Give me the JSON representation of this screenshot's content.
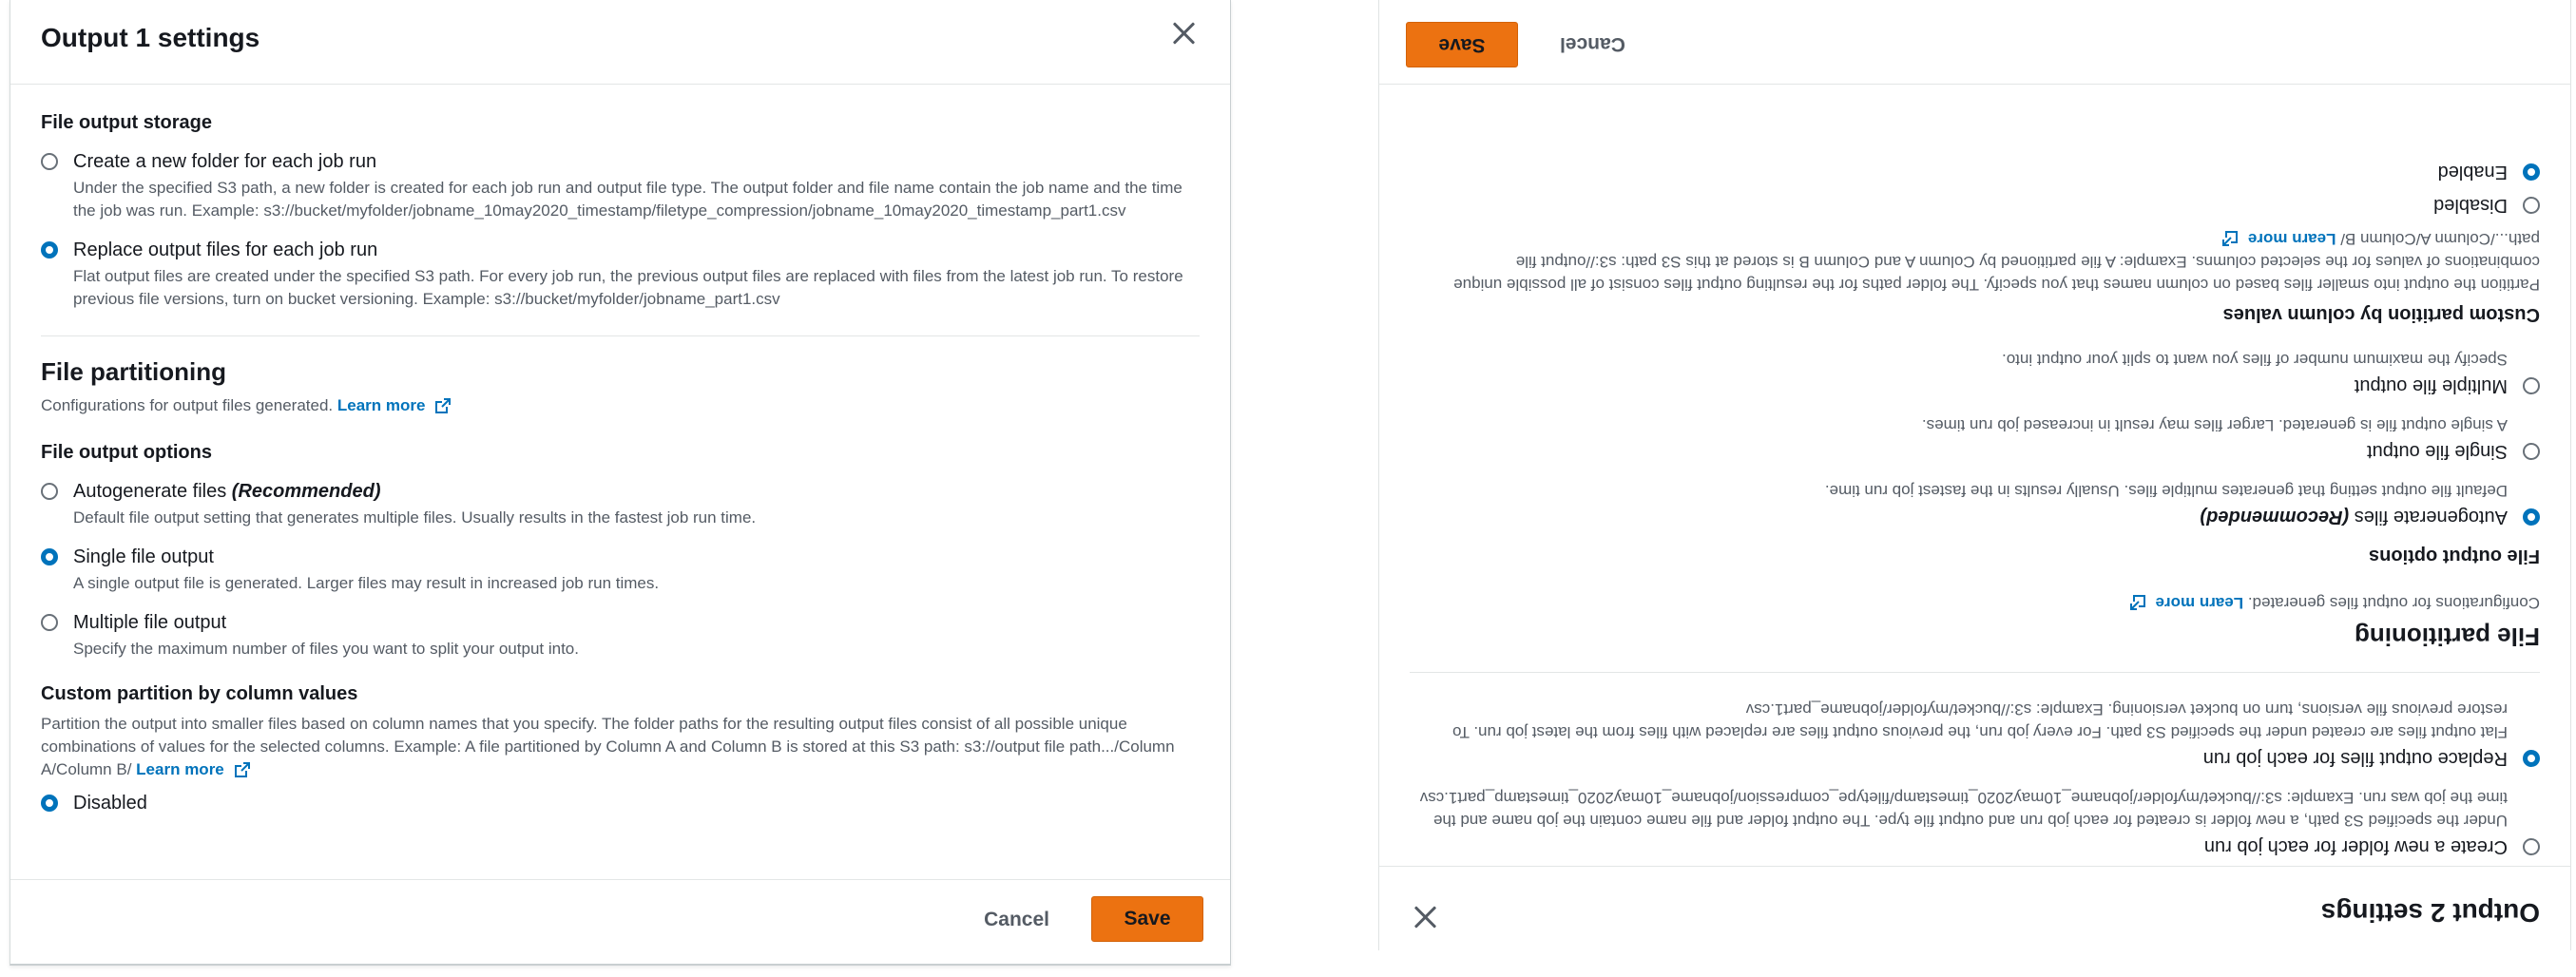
{
  "left": {
    "title": "Output 1 settings",
    "storage_label": "File output storage",
    "storage_options": [
      {
        "label": "Create a new folder for each job run",
        "desc": "Under the specified S3 path, a new folder is created for each job run and output file type. The output folder and file name contain the job name and the time the job was run. Example: s3://bucket/myfolder/jobname_10may2020_timestamp/filetype_compression/jobname_10may2020_timestamp_part1.csv",
        "checked": false
      },
      {
        "label": "Replace output files for each job run",
        "desc": "Flat output files are created under the specified S3 path. For every job run, the previous output files are replaced with files from the latest job run. To restore previous file versions, turn on bucket versioning. Example: s3://bucket/myfolder/jobname_part1.csv",
        "checked": true
      }
    ],
    "partitioning_title": "File partitioning",
    "partitioning_desc": "Configurations for output files generated.",
    "learn_more": "Learn more",
    "output_options_label": "File output options",
    "output_options": [
      {
        "label": "Autogenerate files",
        "label_suffix": "(Recommended)",
        "desc": "Default file output setting that generates multiple files. Usually results in the fastest job run time.",
        "checked": false
      },
      {
        "label": "Single file output",
        "label_suffix": "",
        "desc": "A single output file is generated. Larger files may result in increased job run times.",
        "checked": true
      },
      {
        "label": "Multiple file output",
        "label_suffix": "",
        "desc": "Specify the maximum number of files you want to split your output into.",
        "checked": false
      }
    ],
    "custom_partition_label": "Custom partition by column values",
    "custom_partition_desc": "Partition the output into smaller files based on column names that you specify. The folder paths for the resulting output files consist of all possible unique combinations of values for the selected columns. Example: A file partitioned by Column A and Column B is stored at this S3 path: s3://output file path.../Column A/Column B/",
    "partition_options": [
      {
        "label": "Disabled",
        "checked": true
      }
    ],
    "cancel": "Cancel",
    "save": "Save"
  },
  "right": {
    "title": "Output 2 settings",
    "storage_options": [
      {
        "label": "Create a new folder for each job run",
        "desc": "Under the specified S3 path, a new folder is created for each job run and output file type. The output folder and file name contain the job name and the time the job was run. Example: s3://bucket/myfolder/jobname_10may2020_timestamp/filetype_compression/jobname_10may2020_timestamp_part1.csv",
        "checked": false
      },
      {
        "label": "Replace output files for each job run",
        "desc": "Flat output files are created under the specified S3 path. For every job run, the previous output files are replaced with files from the latest job run. To restore previous file versions, turn on bucket versioning. Example: s3://bucket/myfolder/jobname_part1.csv",
        "checked": true
      }
    ],
    "partitioning_title": "File partitioning",
    "partitioning_desc": "Configurations for output files generated.",
    "learn_more": "Learn more",
    "output_options_label": "File output options",
    "output_options": [
      {
        "label": "Autogenerate files",
        "label_suffix": "(Recommended)",
        "desc": "Default file output setting that generates multiple files. Usually results in the fastest job run time.",
        "checked": true
      },
      {
        "label": "Single file output",
        "label_suffix": "",
        "desc": "A single output file is generated. Larger files may result in increased job run times.",
        "checked": false
      },
      {
        "label": "Multiple file output",
        "label_suffix": "",
        "desc": "Specify the maximum number of files you want to split your output into.",
        "checked": false
      }
    ],
    "custom_partition_label": "Custom partition by column values",
    "custom_partition_desc": "Partition the output into smaller files based on column names that you specify. The folder paths for the resulting output files consist of all possible unique combinations of values for the selected columns. Example: A file partitioned by Column A and Column B is stored at this S3 path: s3://output file path.../Column A/Column B/",
    "partition_options": [
      {
        "label": "Disabled",
        "checked": false
      },
      {
        "label": "Enabled",
        "checked": true
      }
    ],
    "cancel": "Cancel",
    "save": "Save"
  },
  "colors": {
    "accent": "#0073bb",
    "save_button": "#ec7211",
    "text": "#16191f",
    "muted": "#545b64"
  },
  "icons": [
    "close-icon",
    "external-link-icon"
  ]
}
